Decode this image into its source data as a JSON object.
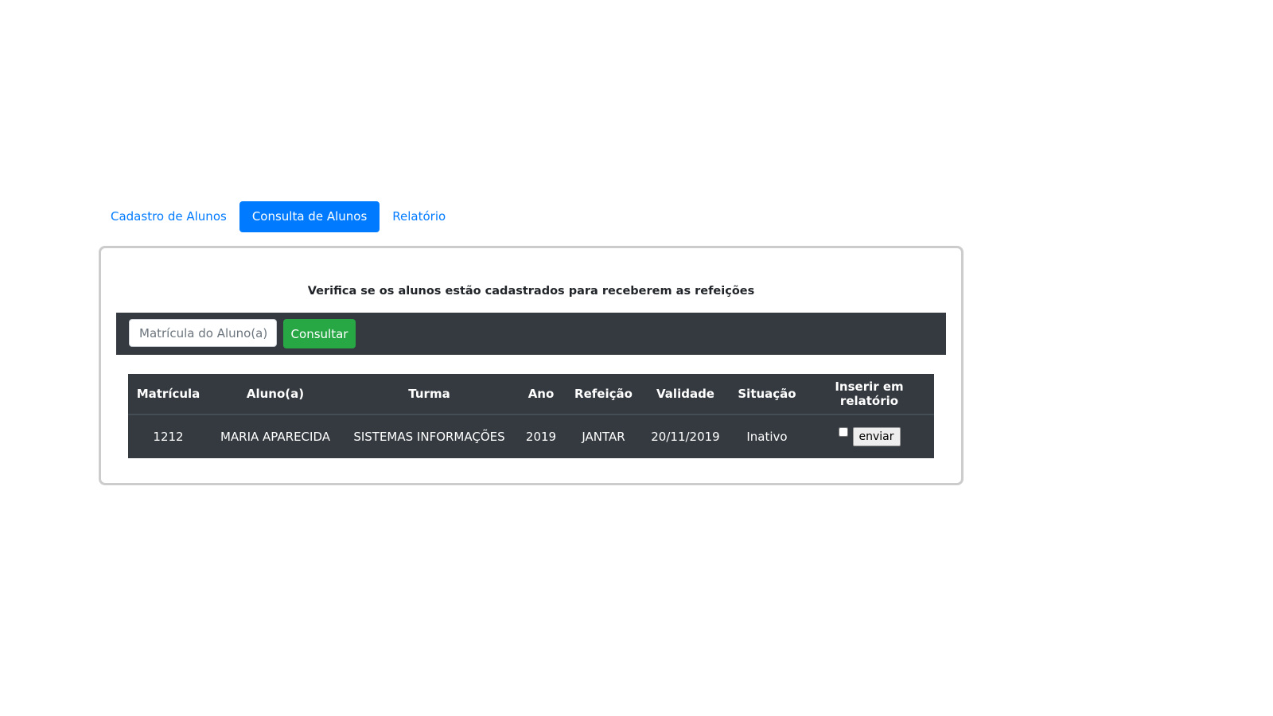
{
  "tabs": [
    "Cadastro de Alunos",
    "Consulta de Alunos",
    "Relatório"
  ],
  "title": "Verifica se os alunos estão cadastrados para receberem as refeições",
  "search": {
    "placeholder": "Matrícula do Aluno(a)",
    "value": "",
    "button": "Consultar"
  },
  "table": {
    "headers": [
      "Matrícula",
      "Aluno(a)",
      "Turma",
      "Ano",
      "Refeição",
      "Validade",
      "Situação",
      "Inserir em relatório"
    ],
    "rows": [
      {
        "matricula": "1212",
        "aluno": "MARIA APARECIDA",
        "turma": "SISTEMAS INFORMAÇÕES",
        "ano": "2019",
        "refeicao": "JANTAR",
        "validade": "20/11/2019",
        "situacao": "Inativo",
        "checked": false,
        "button": "enviar"
      }
    ]
  }
}
